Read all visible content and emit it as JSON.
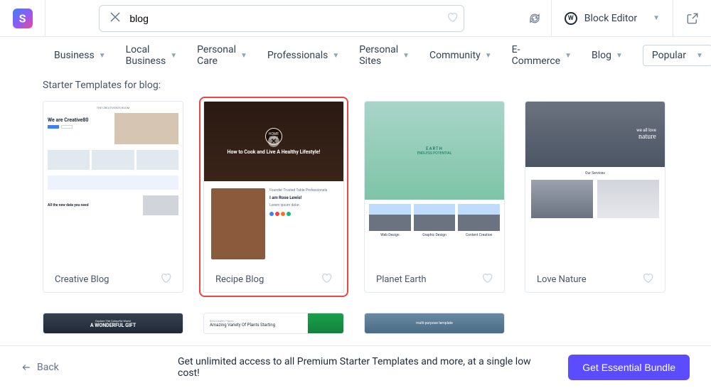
{
  "search": {
    "value": "blog"
  },
  "editor": {
    "label": "Block Editor"
  },
  "filters": [
    "Business",
    "Local Business",
    "Personal Care",
    "Professionals",
    "Personal Sites",
    "Community",
    "E-Commerce",
    "Blog"
  ],
  "sort": {
    "label": "Popular"
  },
  "results": {
    "heading": "Starter Templates for blog:"
  },
  "templates": [
    {
      "name": "Creative Blog",
      "selected": false
    },
    {
      "name": "Recipe Blog",
      "selected": true
    },
    {
      "name": "Planet Earth",
      "selected": false
    },
    {
      "name": "Love Nature",
      "selected": false
    }
  ],
  "preview_text": {
    "creative_title": "THE CREATIVE80'S ROOM",
    "creative_hero": "We are Creative80",
    "creative_data": "All the new data you need",
    "recipe_title": "How to Cook and Live A Healthy Lifestyle!",
    "recipe_badge": "HOME CHEF",
    "recipe_name": "I am Rose Lewis!",
    "earth_title": "EARTH",
    "earth_sub": "ENDLESS POTENTIAL",
    "earth_c1": "Web Design",
    "earth_c2": "Graphic Design",
    "earth_c3": "Content Creation",
    "nature_t1": "we all love",
    "nature_t2": "nature",
    "nature_services": "Our Services",
    "outdoor_s": "Explore The Colourful World",
    "outdoor_b": "A WONDERFUL GIFT",
    "plants_t": "Amazing Variety Of Plants Starting",
    "mountain_t": "multi-purpose template"
  },
  "footer": {
    "back": "Back",
    "promo": "Get unlimited access to all Premium Starter Templates and more, at a single low cost!",
    "cta": "Get Essential Bundle"
  }
}
